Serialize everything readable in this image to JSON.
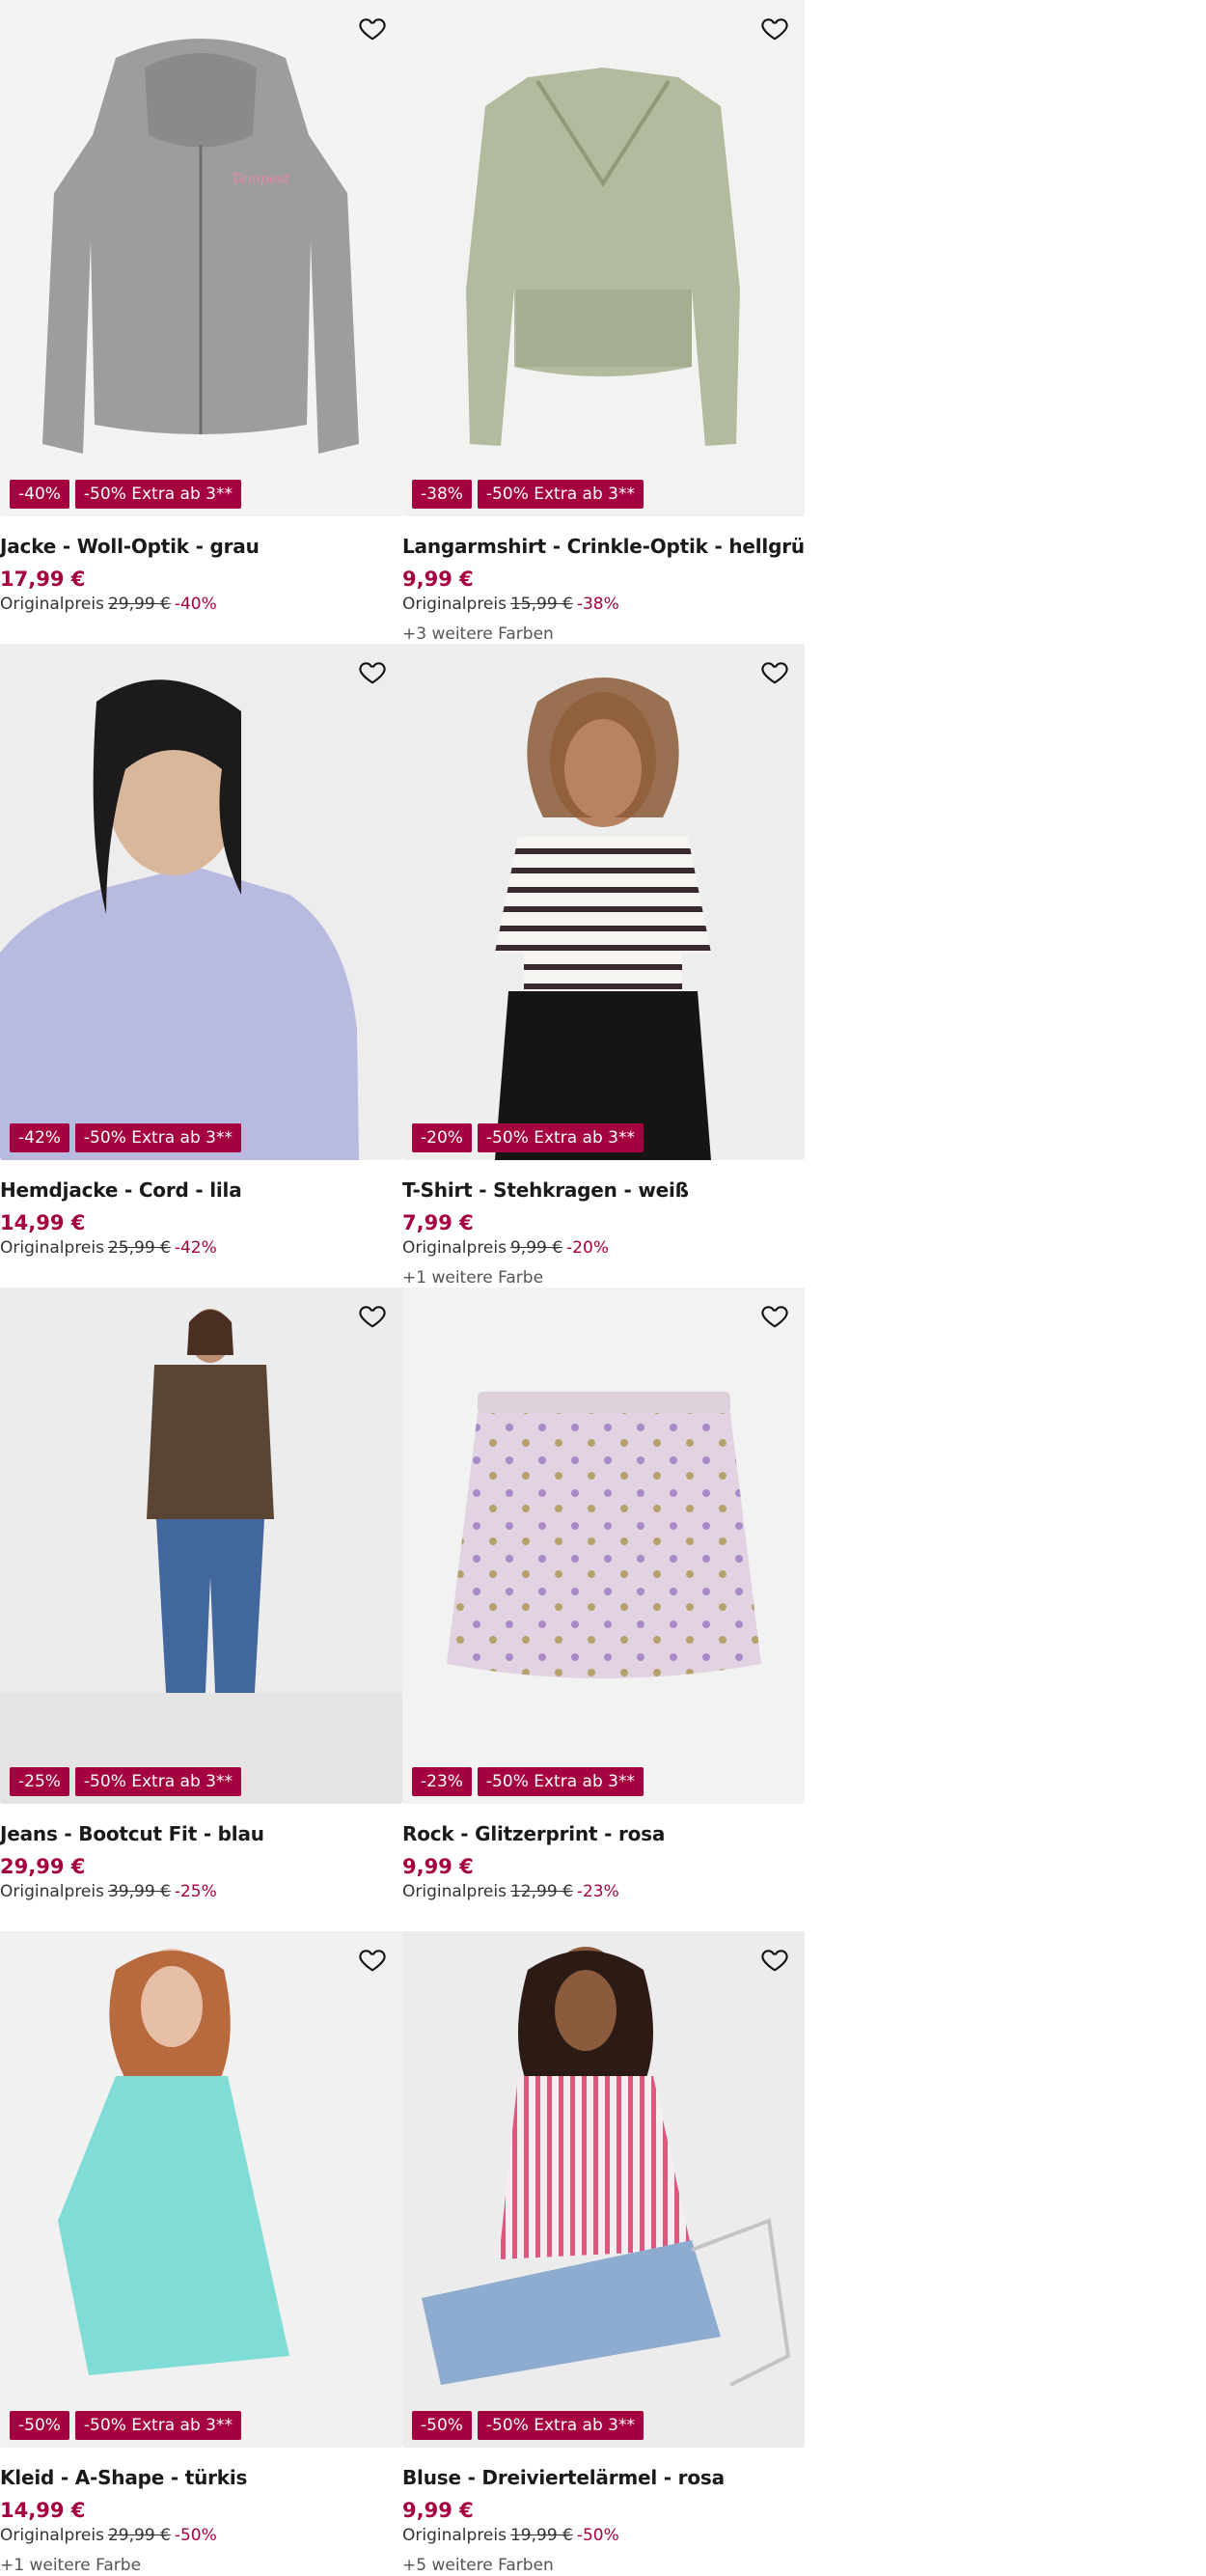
{
  "products": [
    {
      "name": "Jacke - Woll-Optik - grau",
      "price": "17,99 €",
      "orig_label": "Originalpreis",
      "orig_price": "29,99 €",
      "discount": "-40%",
      "badge_discount": "-40%",
      "badge_extra": "-50% Extra ab 3**",
      "colors": "",
      "image": "grey-zip-hoodie"
    },
    {
      "name": "Langarmshirt - Crinkle-Optik - hellgrün",
      "price": "9,99 €",
      "orig_label": "Originalpreis",
      "orig_price": "15,99 €",
      "discount": "-38%",
      "badge_discount": "-38%",
      "badge_extra": "-50% Extra ab 3**",
      "colors": "+3 weitere Farben",
      "image": "green-wrap-top"
    },
    {
      "name": "Hemdjacke - Cord - lila",
      "price": "14,99 €",
      "orig_label": "Originalpreis",
      "orig_price": "25,99 €",
      "discount": "-42%",
      "badge_discount": "-42%",
      "badge_extra": "-50% Extra ab 3**",
      "colors": "",
      "image": "woman-lilac-cord-shirt"
    },
    {
      "name": "T-Shirt - Stehkragen - weiß",
      "price": "7,99 €",
      "orig_label": "Originalpreis",
      "orig_price": "9,99 €",
      "discount": "-20%",
      "badge_discount": "-20%",
      "badge_extra": "-50% Extra ab 3**",
      "colors": "+1 weitere Farbe",
      "image": "woman-striped-tee"
    },
    {
      "name": "Jeans - Bootcut Fit - blau",
      "price": "29,99 €",
      "orig_label": "Originalpreis",
      "orig_price": "39,99 €",
      "discount": "-25%",
      "badge_discount": "-25%",
      "badge_extra": "-50% Extra ab 3**",
      "colors": "",
      "image": "woman-bootcut-jeans"
    },
    {
      "name": "Rock - Glitzerprint - rosa",
      "price": "9,99 €",
      "orig_label": "Originalpreis",
      "orig_price": "12,99 €",
      "discount": "-23%",
      "badge_discount": "-23%",
      "badge_extra": "-50% Extra ab 3**",
      "colors": "",
      "image": "pink-glitter-skirt"
    },
    {
      "name": "Kleid - A-Shape - türkis",
      "price": "14,99 €",
      "orig_label": "Originalpreis",
      "orig_price": "29,99 €",
      "discount": "-50%",
      "badge_discount": "-50%",
      "badge_extra": "-50% Extra ab 3**",
      "colors": "+1 weitere Farbe",
      "image": "woman-turquoise-dress"
    },
    {
      "name": "Bluse - Dreiviertelärmel - rosa",
      "price": "9,99 €",
      "orig_label": "Originalpreis",
      "orig_price": "19,99 €",
      "discount": "-50%",
      "badge_discount": "-50%",
      "badge_extra": "-50% Extra ab 3**",
      "colors": "+5 weitere Farben",
      "image": "woman-pink-striped-blouse"
    }
  ],
  "icons": {
    "favorite": "heart-outline-icon"
  },
  "colors": {
    "accent": "#a5003f",
    "image_bg": "#f2f2f2"
  }
}
